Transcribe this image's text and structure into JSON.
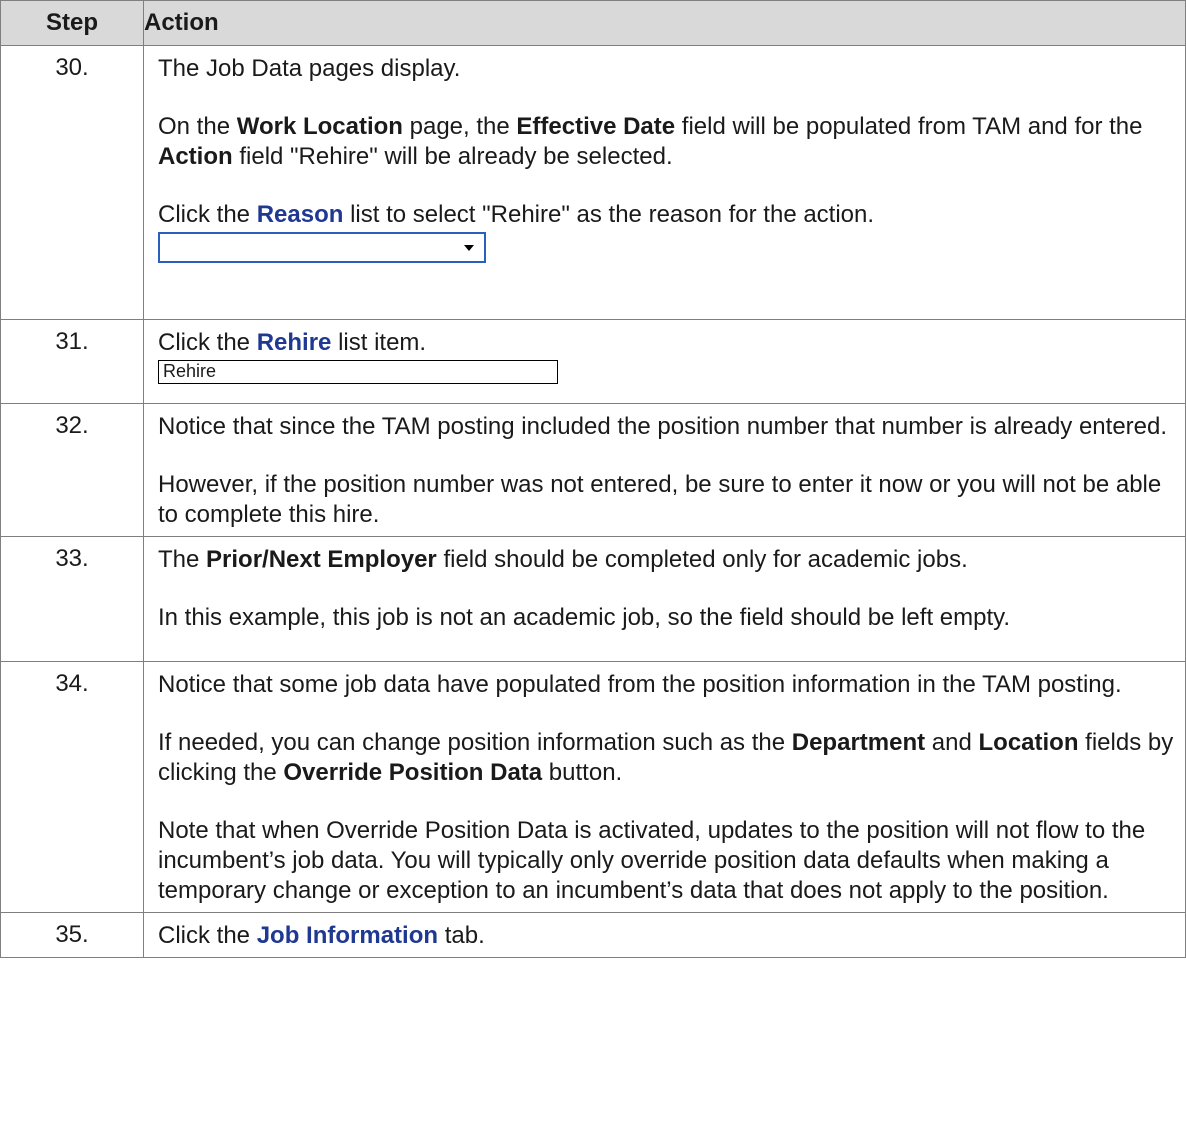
{
  "header": {
    "step": "Step",
    "action": "Action"
  },
  "rows": [
    {
      "num": "30.",
      "p1": "The Job Data pages display.",
      "p2": {
        "t1": "On the ",
        "b1": "Work Location",
        "t2": " page, the ",
        "b2": "Effective Date",
        "t3": " field will be populated from TAM and for the ",
        "b3": "Action",
        "t4": " field \"Rehire\" will be already be selected."
      },
      "p3": {
        "t1": "Click the ",
        "link": "Reason",
        "t2": " list to select \"Rehire\" as the reason for the action."
      },
      "select_value": ""
    },
    {
      "num": "31.",
      "p1": {
        "t1": "Click the ",
        "link": "Rehire",
        "t2": " list item."
      },
      "field_value": "Rehire"
    },
    {
      "num": "32.",
      "p1": "Notice that since the TAM posting included the position number that number is already entered.",
      "p2": "However, if the position number was not entered, be sure to enter it now or you will not be able to complete this hire."
    },
    {
      "num": "33.",
      "p1": {
        "t1": "The ",
        "b1": "Prior/Next Employer",
        "t2": " field should be completed only for academic jobs."
      },
      "p2": "In this example, this job is not an academic job, so the field should be left empty."
    },
    {
      "num": "34.",
      "p1": "Notice that some job data have populated from the position information in the TAM posting.",
      "p2": {
        "t1": "If needed, you can change position information such as the ",
        "b1": "Department",
        "t2": " and ",
        "b2": "Location",
        "t3": " fields by clicking the ",
        "b3": "Override Position Data",
        "t4": " button."
      },
      "p3": "Note that when Override Position Data is activated, updates to the position will not flow to the incumbent’s job data. You will typically only override position data defaults when making a temporary change or exception to an incumbent’s data that does not apply to the position."
    },
    {
      "num": "35.",
      "p1": {
        "t1": "Click the ",
        "link": "Job Information",
        "t2": " tab."
      }
    }
  ]
}
